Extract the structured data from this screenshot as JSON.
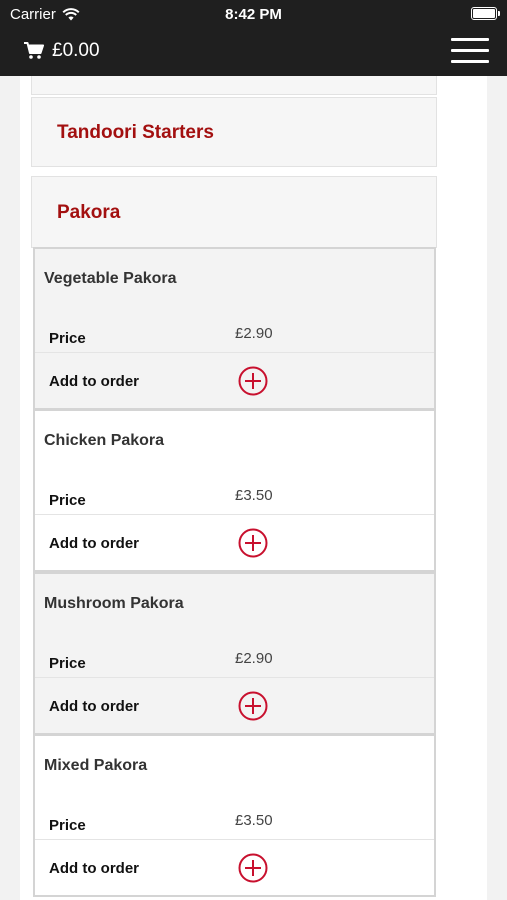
{
  "status_bar": {
    "carrier": "Carrier",
    "time": "8:42 PM"
  },
  "header": {
    "cart_total": "£0.00"
  },
  "sections": [
    {
      "title": "Tandoori Starters"
    },
    {
      "title": "Pakora"
    }
  ],
  "items": [
    {
      "name": "Vegetable Pakora",
      "price_label": "Price",
      "price": "£2.90",
      "add_label": "Add to order"
    },
    {
      "name": "Chicken Pakora",
      "price_label": "Price",
      "price": "£3.50",
      "add_label": "Add to order"
    },
    {
      "name": "Mushroom Pakora",
      "price_label": "Price",
      "price": "£2.90",
      "add_label": "Add to order"
    },
    {
      "name": "Mixed Pakora",
      "price_label": "Price",
      "price": "£3.50",
      "add_label": "Add to order"
    }
  ],
  "colors": {
    "header_bg": "#1f1f1f",
    "section_title": "#a31010",
    "add_icon": "#c8102e"
  }
}
